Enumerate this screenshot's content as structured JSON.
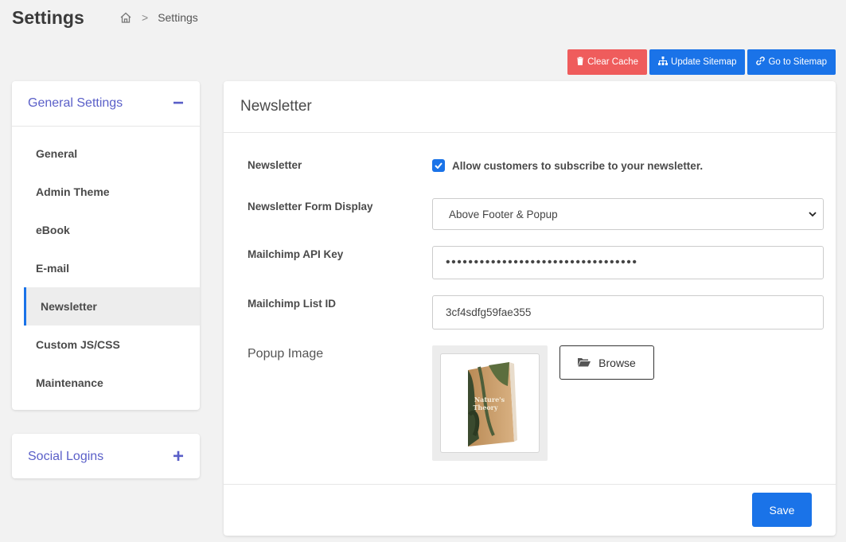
{
  "page": {
    "title": "Settings",
    "breadcrumb": {
      "separator": ">",
      "current": "Settings"
    }
  },
  "actions": {
    "clear_cache": "Clear Cache",
    "update_sitemap": "Update Sitemap",
    "go_to_sitemap": "Go to Sitemap"
  },
  "sidebar": {
    "general_title": "General Settings",
    "general_toggle": "−",
    "items": [
      {
        "label": "General"
      },
      {
        "label": "Admin Theme"
      },
      {
        "label": "eBook"
      },
      {
        "label": "E-mail"
      },
      {
        "label": "Newsletter",
        "active": true
      },
      {
        "label": "Custom JS/CSS"
      },
      {
        "label": "Maintenance"
      }
    ],
    "social_title": "Social Logins",
    "social_toggle": "+"
  },
  "panel": {
    "title": "Newsletter",
    "fields": {
      "newsletter_label": "Newsletter",
      "newsletter_checkbox_label": "Allow customers to subscribe to your newsletter.",
      "newsletter_checked": true,
      "form_display_label": "Newsletter Form Display",
      "form_display_value": "Above Footer & Popup",
      "api_key_label": "Mailchimp API Key",
      "api_key_value": "••••••••••••••••••••••••••••••••••",
      "list_id_label": "Mailchimp List ID",
      "list_id_value": "3cf4sdfg59fae355",
      "popup_image_label": "Popup Image",
      "book_title": "Nature's Theory",
      "browse_label": "Browse"
    },
    "save_label": "Save"
  },
  "colors": {
    "accent": "#1a73e8",
    "danger": "#ef5c5c",
    "sidebar_heading": "#5a5fc8"
  }
}
